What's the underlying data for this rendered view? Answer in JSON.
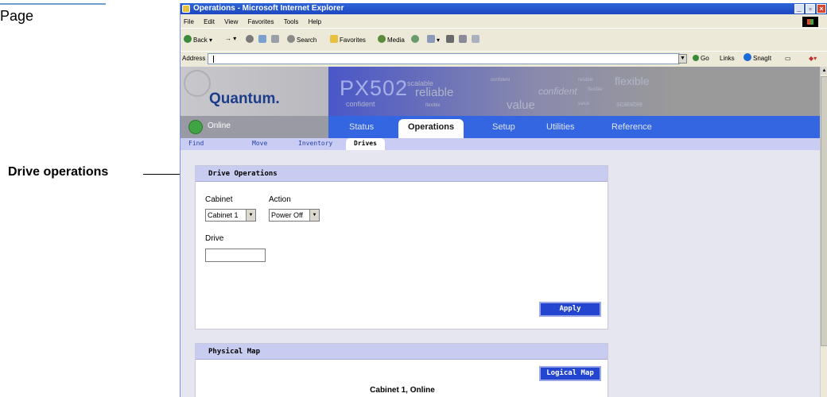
{
  "doc": {
    "title_fragment": "Page",
    "callout": "Drive operations"
  },
  "browser": {
    "title": "Operations - Microsoft Internet Explorer",
    "menu": [
      "File",
      "Edit",
      "View",
      "Favorites",
      "Tools",
      "Help"
    ],
    "toolbar": {
      "back": "Back",
      "search": "Search",
      "favorites": "Favorites",
      "media": "Media"
    },
    "address_label": "Address",
    "address_value": "",
    "go": "Go",
    "links": "Links",
    "snagit": "SnagIt"
  },
  "app": {
    "brand": "Quantum.",
    "product": "PX502",
    "banner_words": [
      "reliable",
      "value",
      "flexible",
      "scalable",
      "confident",
      "confident",
      "scalable",
      "flexible",
      "reliable",
      "value",
      "flexible"
    ],
    "status": "Online",
    "tabs": [
      "Status",
      "Operations",
      "Setup",
      "Utilities",
      "Reference"
    ],
    "active_tab": "Operations",
    "subtabs": [
      "Find",
      "Move",
      "Inventory",
      "Drives"
    ],
    "active_subtab": "Drives"
  },
  "drive_ops": {
    "header": "Drive Operations",
    "cabinet_label": "Cabinet",
    "cabinet_value": "Cabinet 1",
    "action_label": "Action",
    "action_value": "Power Off",
    "drive_label": "Drive",
    "drive_value": "",
    "apply": "Apply"
  },
  "physical_map": {
    "header": "Physical Map",
    "logical_button": "Logical Map",
    "cabinet_status": "Cabinet 1, Online"
  },
  "colors": {
    "nav_blue": "#3366e0",
    "panel_header": "#c8ccf0",
    "button_blue": "#2445d0",
    "status_green": "#3fa442"
  }
}
